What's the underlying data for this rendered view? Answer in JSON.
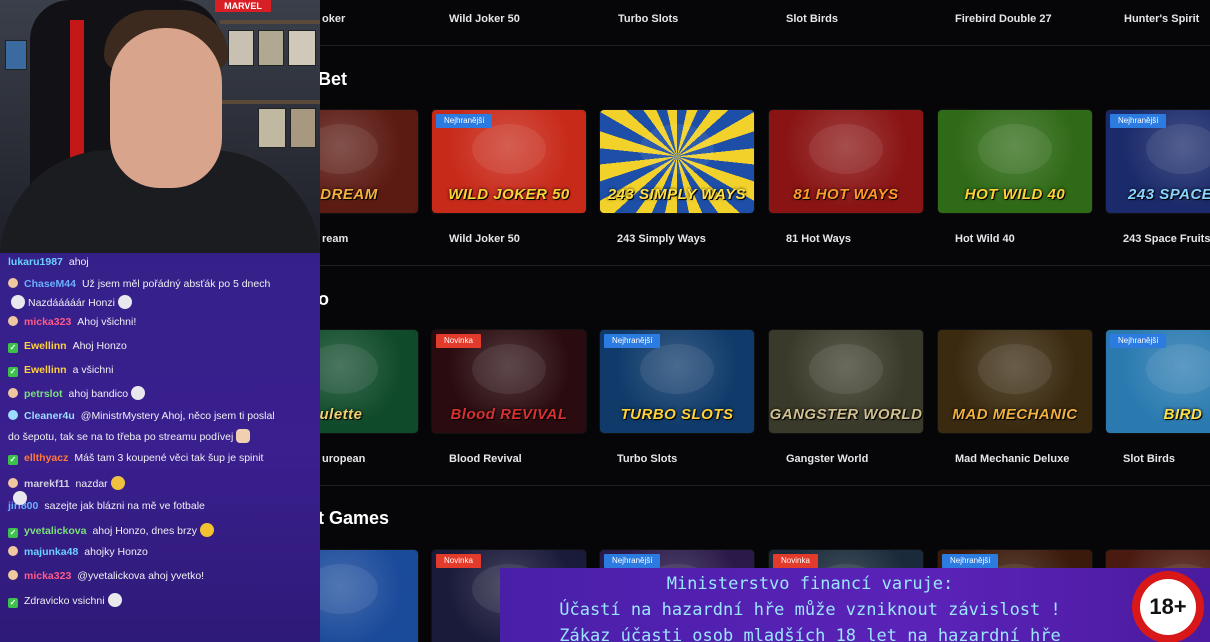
{
  "top_row": {
    "names": [
      "oker",
      "Wild Joker 50",
      "Turbo Slots",
      "Slot Birds",
      "Firebird Double 27",
      "Hunter's Spirit"
    ]
  },
  "sections": [
    {
      "title": "Bet",
      "games": [
        {
          "name": "ream",
          "art": "R DREAM",
          "badge": "",
          "bg": "#5b1a12",
          "art_color": "#f5b040"
        },
        {
          "name": "Wild Joker 50",
          "art": "WILD JOKER 50",
          "badge": "Nejhranější",
          "badge_color": "blue",
          "bg": "#c82a1a",
          "art_color": "#ffd23a"
        },
        {
          "name": "243 Simply Ways",
          "art": "243 SIMPLY WAYS",
          "badge": "",
          "bg": "#1c4fa0",
          "art_color": "#ffe14a"
        },
        {
          "name": "81 Hot Ways",
          "art": "81 HOT WAYS",
          "badge": "",
          "bg": "#8a1414",
          "art_color": "#ff9a2a"
        },
        {
          "name": "Hot Wild 40",
          "art": "HOT WILD 40",
          "badge": "",
          "bg": "#2f6a16",
          "art_color": "#ffd23a"
        },
        {
          "name": "243 Space Fruits",
          "art": "243 SPACE FR",
          "badge": "Nejhranější",
          "badge_color": "blue",
          "bg": "#1a2a6a",
          "art_color": "#8ad4ff"
        }
      ]
    },
    {
      "title": "o",
      "games": [
        {
          "name": "uropean",
          "art": "ulette",
          "badge": "",
          "bg": "#0f4a2a",
          "art_color": "#f0d070"
        },
        {
          "name": "Blood Revival",
          "art": "Blood REVIVAL",
          "badge": "Novinka",
          "badge_color": "red",
          "bg": "#2a0c10",
          "art_color": "#d83030"
        },
        {
          "name": "Turbo Slots",
          "art": "TURBO SLOTS",
          "badge": "Nejhranější",
          "badge_color": "blue",
          "bg": "#0f3a6a",
          "art_color": "#ffd23a"
        },
        {
          "name": "Gangster World",
          "art": "GANGSTER WORLD",
          "badge": "",
          "bg": "#3a3a2a",
          "art_color": "#d0c090"
        },
        {
          "name": "Mad Mechanic Deluxe",
          "art": "MAD MECHANIC",
          "badge": "",
          "bg": "#3a2a10",
          "art_color": "#f0b040"
        },
        {
          "name": "Slot Birds",
          "art": "BIRD",
          "badge": "Nejhranější",
          "badge_color": "blue",
          "bg": "#2a7ab0",
          "art_color": "#ffe14a"
        }
      ]
    },
    {
      "title": "t Games",
      "games": [
        {
          "name": "",
          "art": "",
          "badge": "",
          "bg": "#1a4a9a",
          "art_color": "#fff"
        },
        {
          "name": "",
          "art": "",
          "badge": "Novinka",
          "badge_color": "red",
          "bg": "#1a1a3a",
          "art_color": "#fff"
        },
        {
          "name": "",
          "art": "",
          "badge": "Nejhranější",
          "badge_color": "blue",
          "bg": "#2a1a4a",
          "art_color": "#fff"
        },
        {
          "name": "",
          "art": "",
          "badge": "Novinka",
          "badge_color": "red",
          "bg": "#1a2a3a",
          "art_color": "#fff"
        },
        {
          "name": "",
          "art": "",
          "badge": "Nejhranější",
          "badge_color": "blue",
          "bg": "#3a1a0a",
          "art_color": "#fff"
        },
        {
          "name": "",
          "art": "",
          "badge": "",
          "bg": "#4a1a10",
          "art_color": "#fff"
        }
      ]
    }
  ],
  "webcam": {
    "logo": "MARVEL"
  },
  "chat": {
    "messages": [
      {
        "user": "lukaru1987",
        "user_color": "#6ad0ff",
        "icon": "",
        "text": "ahoj"
      },
      {
        "user": "ChaseM44",
        "user_color": "#6ab0ff",
        "icon": "face",
        "text": "Už jsem měl pořádný absťák po 5 dnech"
      },
      {
        "user": "",
        "user_color": "#fff",
        "icon": "",
        "text": "Nazdááááár Honzi"
      },
      {
        "user": "micka323",
        "user_color": "#ff5a8a",
        "icon": "face",
        "text": "Ahoj všichni!"
      },
      {
        "user": "Ewellinn",
        "user_color": "#ffd23a",
        "icon": "check",
        "text": "Ahoj Honzo"
      },
      {
        "user": "Ewellinn",
        "user_color": "#ffd23a",
        "icon": "check",
        "text": "a všichni"
      },
      {
        "user": "petrslot",
        "user_color": "#7ae07a",
        "icon": "face",
        "text": "ahoj bandico"
      },
      {
        "user": "Cleaner4u",
        "user_color": "#9bdcff",
        "icon": "cleaner",
        "text": "@MinistrMystery Ahoj, něco jsem ti poslal"
      },
      {
        "user": "",
        "user_color": "#fff",
        "icon": "",
        "text": "do šepotu, tak se na to třeba po streamu podívej"
      },
      {
        "user": "ellthyacz",
        "user_color": "#ff7a3a",
        "icon": "check",
        "text": "Máš tam 3 koupené věci tak šup je spinit"
      },
      {
        "user": "marekf11",
        "user_color": "#cfcfe0",
        "icon": "face",
        "text": "nazdar"
      },
      {
        "user": "jiri800",
        "user_color": "#6ab0ff",
        "icon": "",
        "text": "sazejte jak blázni na mě ve fotbale"
      },
      {
        "user": "yvetalickova",
        "user_color": "#7ae07a",
        "icon": "check",
        "text": "ahoj Honzo, dnes brzy"
      },
      {
        "user": "majunka48",
        "user_color": "#6ad0ff",
        "icon": "face",
        "text": "ahojky Honzo"
      },
      {
        "user": "micka323",
        "user_color": "#ff5a8a",
        "icon": "face",
        "text": "@yvetalickova ahoj yvetko!"
      },
      {
        "user": "",
        "user_color": "#fff",
        "icon": "check",
        "text": "Zdravicko vsichni"
      }
    ]
  },
  "warning": {
    "line1": "Ministerstvo financí varuje:",
    "line2": "Účastí na hazardní hře může vzniknout závislost !",
    "line3": "Zákaz účasti osob mladších 18 let na hazardní hře",
    "age": "18+"
  }
}
